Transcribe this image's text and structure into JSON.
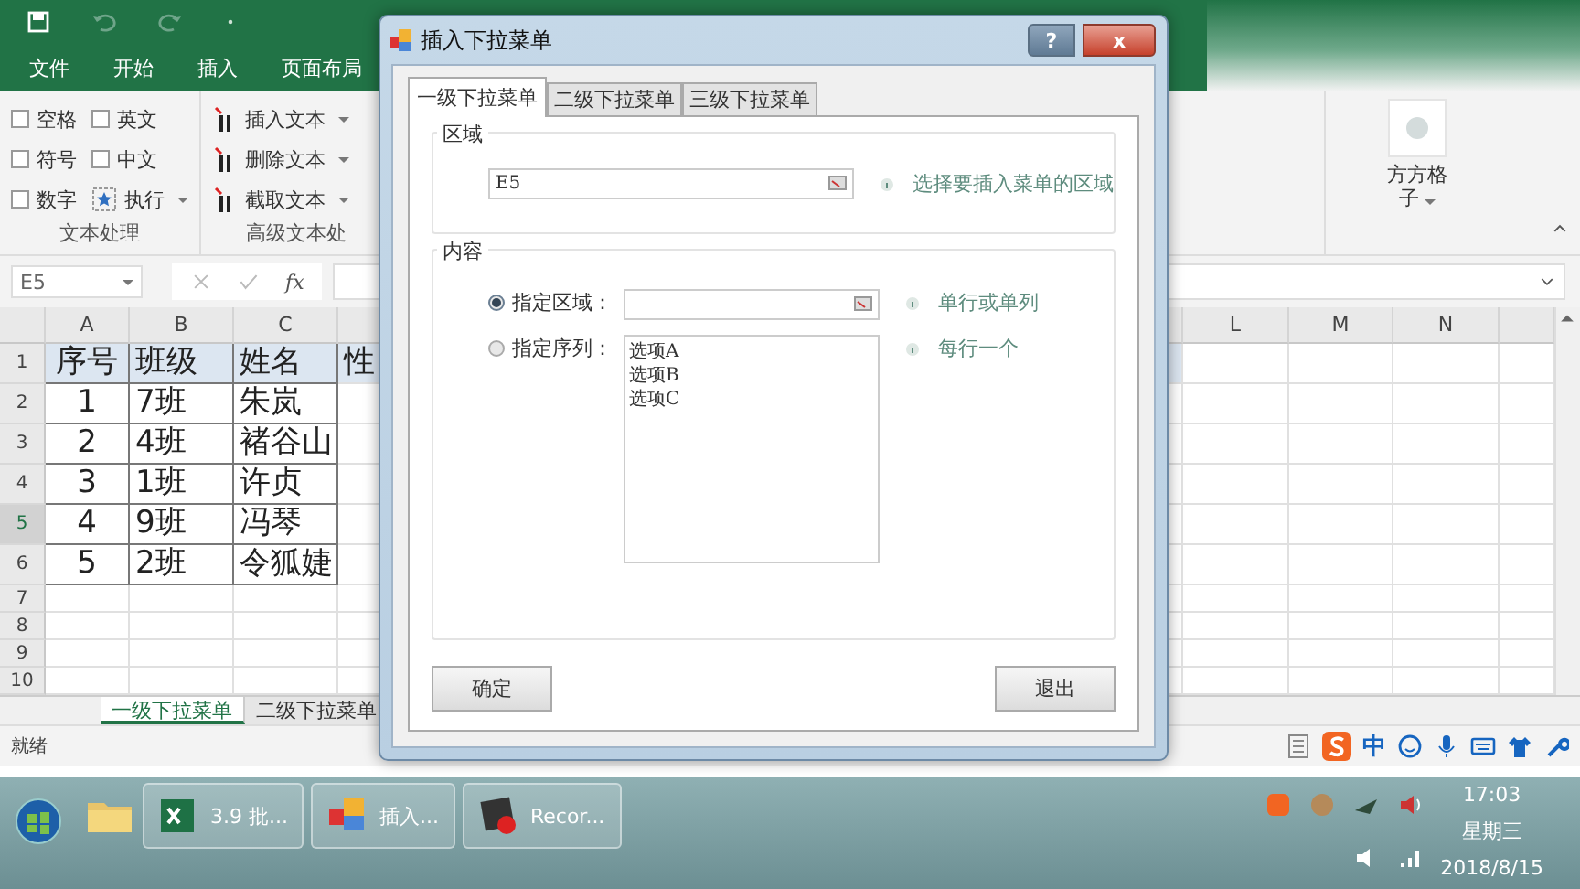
{
  "excel": {
    "ribbon_tabs": [
      "文件",
      "开始",
      "插入",
      "页面布局"
    ],
    "text_group": {
      "label": "文本处理",
      "options": [
        {
          "label": "空格",
          "checked": false
        },
        {
          "label": "英文",
          "checked": false
        },
        {
          "label": "符号",
          "checked": false
        },
        {
          "label": "中文",
          "checked": false
        },
        {
          "label": "数字",
          "checked": false
        }
      ],
      "run_button": "执行"
    },
    "advanced_group": {
      "label": "高级文本处",
      "buttons": [
        "插入文本",
        "删除文本",
        "截取文本"
      ]
    },
    "addin_button": "方方格子",
    "name_box": "E5",
    "fx": "fx",
    "columns_left": [
      "A",
      "B",
      "C"
    ],
    "columns_right": [
      "L",
      "M",
      "N"
    ],
    "rows": [
      {
        "number": "1",
        "selected": false,
        "cells": [
          "序号",
          "班级",
          "姓名",
          "性"
        ]
      },
      {
        "number": "2",
        "selected": false,
        "cells": [
          "1",
          "7班",
          "朱岚"
        ]
      },
      {
        "number": "3",
        "selected": false,
        "cells": [
          "2",
          "4班",
          "褚谷山"
        ]
      },
      {
        "number": "4",
        "selected": false,
        "cells": [
          "3",
          "1班",
          "许贞"
        ]
      },
      {
        "number": "5",
        "selected": true,
        "cells": [
          "4",
          "9班",
          "冯琴"
        ]
      },
      {
        "number": "6",
        "selected": false,
        "cells": [
          "5",
          "2班",
          "令狐婕"
        ]
      },
      {
        "number": "7",
        "selected": false,
        "cells": []
      },
      {
        "number": "8",
        "selected": false,
        "cells": []
      },
      {
        "number": "9",
        "selected": false,
        "cells": []
      },
      {
        "number": "10",
        "selected": false,
        "cells": []
      }
    ],
    "sheet_tabs": [
      {
        "label": "一级下拉菜单",
        "selected": true
      },
      {
        "label": "二级下拉菜单",
        "selected": false
      }
    ],
    "status": "就绪",
    "ime_label": "中"
  },
  "dialog": {
    "title": "插入下拉菜单",
    "help": "?",
    "close": "x",
    "tabs": [
      {
        "label": "一级下拉菜单",
        "selected": true
      },
      {
        "label": "二级下拉菜单",
        "selected": false
      },
      {
        "label": "三级下拉菜单",
        "selected": false
      }
    ],
    "range_group": {
      "label": "区域",
      "value": "E5",
      "hint": "选择要插入菜单的区域"
    },
    "content_group": {
      "label": "内容",
      "options": [
        {
          "kind": "range",
          "label": "指定区域：",
          "selected": true,
          "hint": "单行或单列"
        },
        {
          "kind": "list",
          "label": "指定序列：",
          "selected": false,
          "lines": [
            "选项A",
            "选项B",
            "选项C"
          ],
          "hint": "每行一个"
        }
      ]
    },
    "buttons": [
      "确定",
      "退出"
    ]
  },
  "taskbar": {
    "items": [
      {
        "kind": "excel",
        "label": "3.9 批..."
      },
      {
        "kind": "addin",
        "label": "插入..."
      },
      {
        "kind": "recorder",
        "label": "Recor..."
      }
    ],
    "time": "17:03",
    "weekday": "星期三",
    "date": "2018/8/15"
  }
}
